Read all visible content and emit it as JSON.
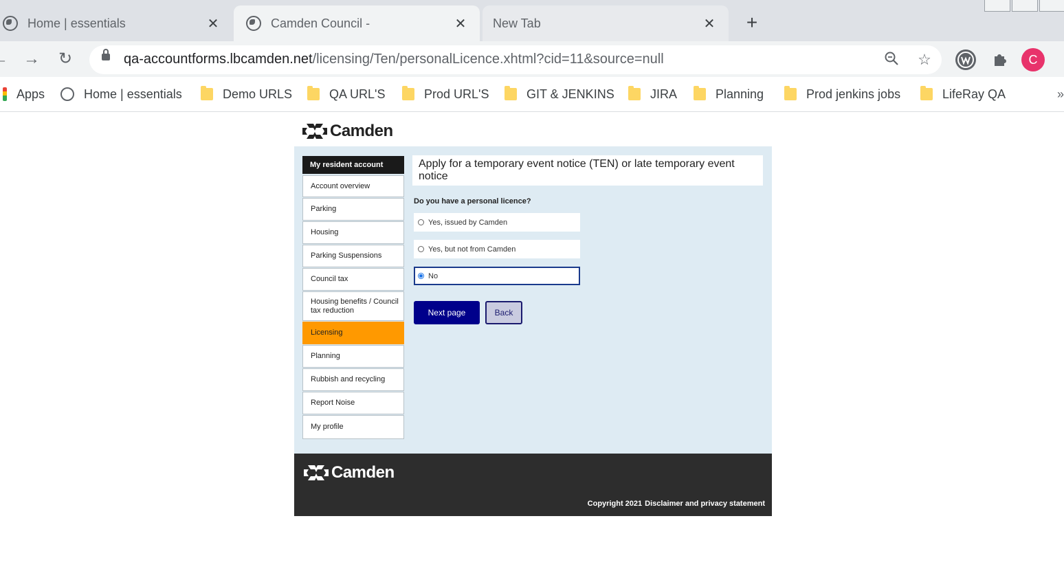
{
  "browser": {
    "tabs": [
      {
        "title": "Home | essentials",
        "state": "inactive"
      },
      {
        "title": "Camden Council -",
        "state": "active"
      },
      {
        "title": "New Tab",
        "state": "inactive"
      }
    ],
    "url_host": "qa-accountforms.lbcamden.net",
    "url_path": "/licensing/Ten/personalLicence.xhtml?cid=11&source=null",
    "profile_initial": "C",
    "bookmarks": [
      "Apps",
      "Home | essentials",
      "Demo URLS",
      "QA URL'S",
      "Prod URL'S",
      "GIT & JENKINS",
      "JIRA",
      "Planning",
      "Prod jenkins jobs",
      "LifeRay QA"
    ],
    "bookmark_overflow": "»"
  },
  "site": {
    "logo_text": "Camden",
    "nav_header": "My resident account",
    "nav_items": [
      "Account overview",
      "Parking",
      "Housing",
      "Parking Suspensions",
      "Council tax",
      "Housing benefits / Council tax reduction",
      "Licensing",
      "Planning",
      "Rubbish and recycling",
      "Report Noise",
      "My profile"
    ],
    "active_nav": "Licensing",
    "page_title": "Apply for a temporary event notice (TEN) or late temporary event notice",
    "question": "Do you have a personal licence?",
    "options": [
      "Yes, issued by Camden",
      "Yes, but not from Camden",
      "No"
    ],
    "selected_option": "No",
    "next_label": "Next page",
    "back_label": "Back",
    "footer_logo_text": "Camden",
    "footer_copyright": "Copyright 2021",
    "footer_link": "Disclaimer and privacy statement"
  },
  "colors": {
    "active_nav": "#ff9900",
    "primary_button": "#00008b",
    "card_background": "#deebf3",
    "footer_background": "#2d2d2d",
    "profile": "#e8336b"
  }
}
